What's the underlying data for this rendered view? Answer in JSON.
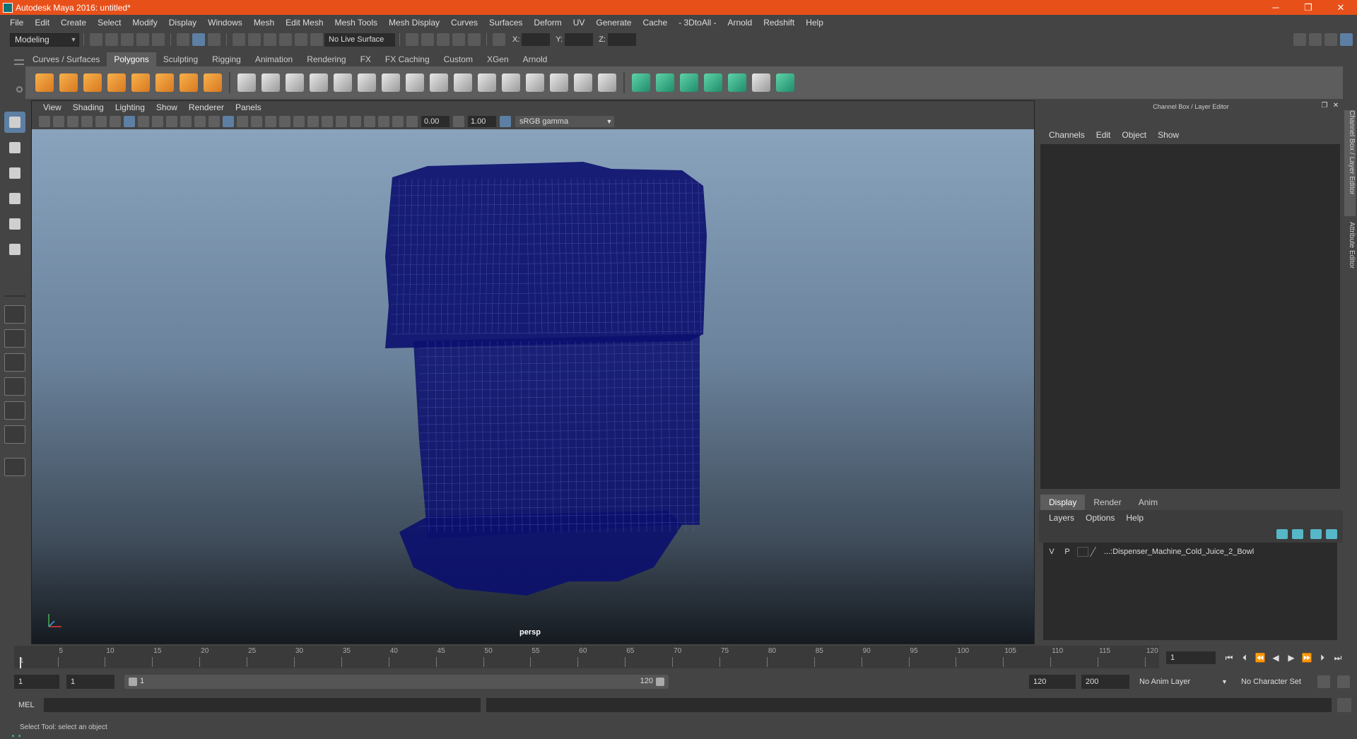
{
  "window": {
    "title": "Autodesk Maya 2016: untitled*",
    "minimize": "─",
    "restore": "❐",
    "close": "✕"
  },
  "menubar": [
    "File",
    "Edit",
    "Create",
    "Select",
    "Modify",
    "Display",
    "Windows",
    "Mesh",
    "Edit Mesh",
    "Mesh Tools",
    "Mesh Display",
    "Curves",
    "Surfaces",
    "Deform",
    "UV",
    "Generate",
    "Cache",
    "- 3DtoAll -",
    "Arnold",
    "Redshift",
    "Help"
  ],
  "statusline": {
    "mode": "Modeling",
    "live_surface": "No Live Surface",
    "x_label": "X:",
    "y_label": "Y:",
    "z_label": "Z:"
  },
  "shelf": {
    "tabs": [
      "Curves / Surfaces",
      "Polygons",
      "Sculpting",
      "Rigging",
      "Animation",
      "Rendering",
      "FX",
      "FX Caching",
      "Custom",
      "XGen",
      "Arnold"
    ],
    "active_tab": "Polygons"
  },
  "viewport": {
    "menus": [
      "View",
      "Shading",
      "Lighting",
      "Show",
      "Renderer",
      "Panels"
    ],
    "exposure": "0.00",
    "gamma": "1.00",
    "color_space": "sRGB gamma",
    "camera_label": "persp",
    "wire_color": "#0b0f6e"
  },
  "channelbox": {
    "header": "Channel Box / Layer Editor",
    "menus": [
      "Channels",
      "Edit",
      "Object",
      "Show"
    ],
    "layer_tabs": [
      "Display",
      "Render",
      "Anim"
    ],
    "active_layer_tab": "Display",
    "layer_menus": [
      "Layers",
      "Options",
      "Help"
    ],
    "layers": [
      {
        "visible": "V",
        "playback": "P",
        "name": "...:Dispenser_Machine_Cold_Juice_2_Bowl"
      }
    ]
  },
  "side_tabs": [
    "Channel Box / Layer Editor",
    "Attribute Editor"
  ],
  "timeslider": {
    "ticks": [
      5,
      10,
      15,
      20,
      25,
      30,
      35,
      40,
      45,
      50,
      55,
      60,
      65,
      70,
      75,
      80,
      85,
      90,
      95,
      100,
      105,
      110,
      115,
      120
    ],
    "start_label": "1",
    "current_frame": "1"
  },
  "range": {
    "start": "1",
    "playback_start": "1",
    "slider_start": "1",
    "slider_end": "120",
    "playback_end": "120",
    "end": "200",
    "anim_layer": "No Anim Layer",
    "character_set": "No Character Set"
  },
  "cmdline": {
    "label": "MEL"
  },
  "helpline": {
    "text": "Select Tool: select an object"
  }
}
